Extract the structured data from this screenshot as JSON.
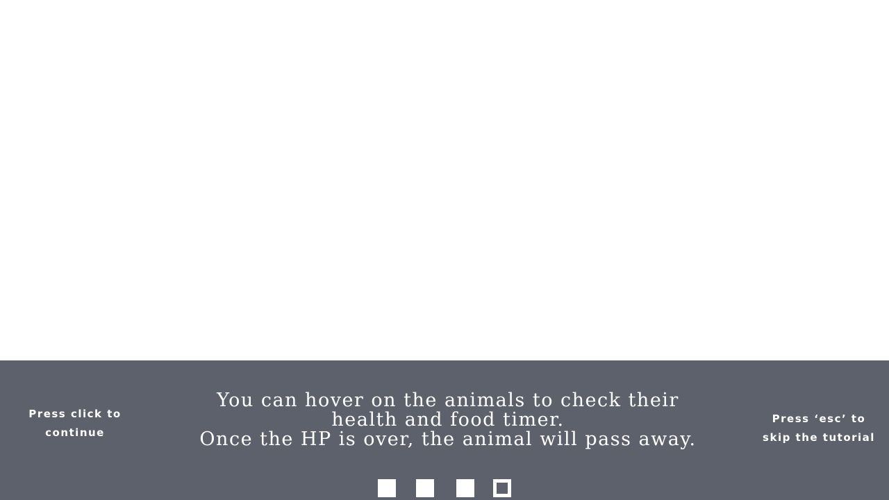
{
  "game": {
    "scene": "blank"
  },
  "tutorial": {
    "hint_continue": "Press click to continue",
    "message_lines": [
      "You can hover on the animals to check their",
      "health and food timer.",
      "Once the HP is over, the animal will pass away."
    ],
    "hint_skip": "Press ‘esc’ to skip the tutorial",
    "steps": {
      "total": 4,
      "current": 4
    }
  },
  "colors": {
    "panel_background": "#5d616b",
    "text": "#ffffff",
    "scene_background": "#ffffff"
  }
}
